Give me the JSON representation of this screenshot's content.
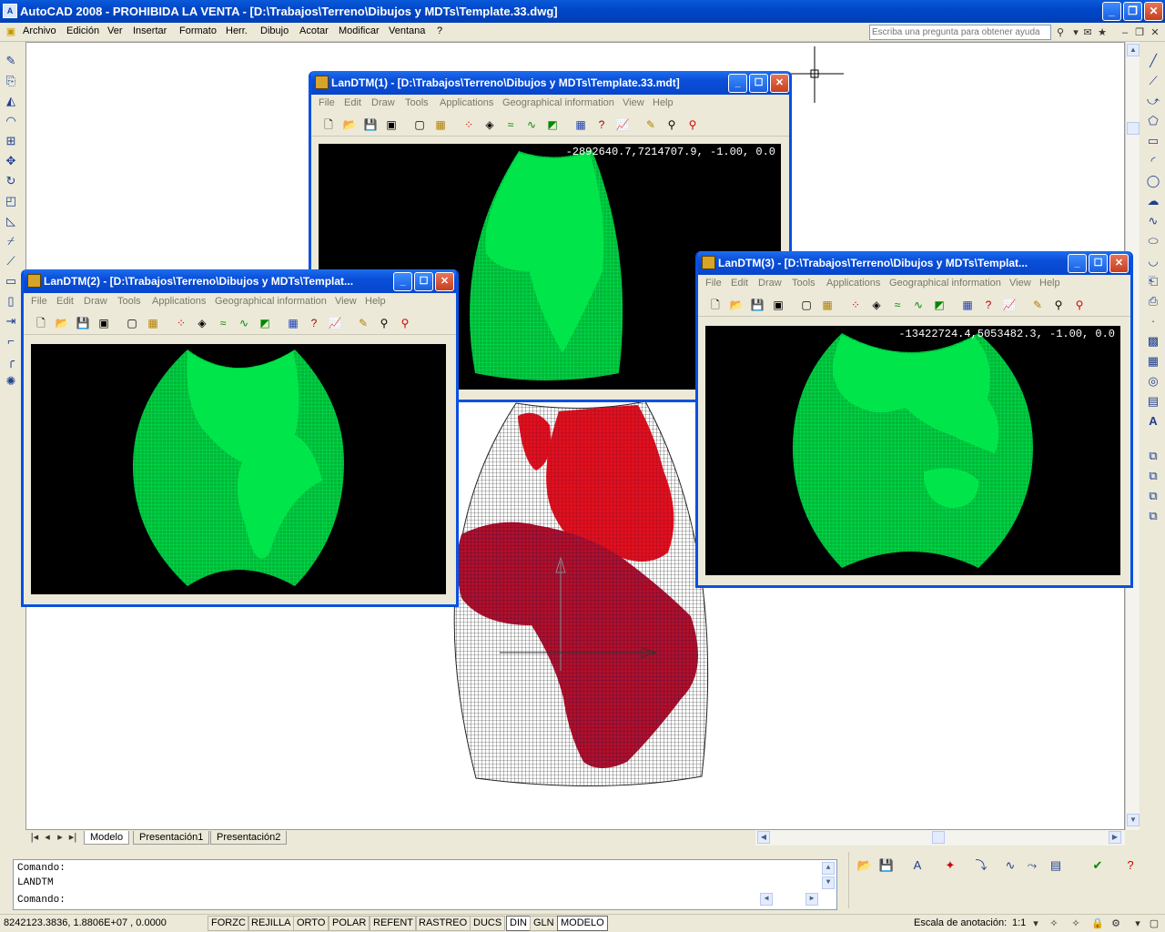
{
  "app": {
    "title": "AutoCAD 2008 - PROHIBIDA LA VENTA - [D:\\Trabajos\\Terreno\\Dibujos y MDTs\\Template.33.dwg]",
    "icon_label": "A"
  },
  "menu": [
    "Archivo",
    "Edición",
    "Ver",
    "Insertar",
    "Formato",
    "Herr.",
    "Dibujo",
    "Acotar",
    "Modificar",
    "Ventana",
    "?"
  ],
  "help_search": {
    "placeholder": "Escriba una pregunta para obtener ayuda"
  },
  "tabs": [
    "Modelo",
    "Presentación1",
    "Presentación2"
  ],
  "active_tab": "Modelo",
  "command": {
    "line1": "Comando:",
    "line2": "LANDTM",
    "prompt": "Comando:"
  },
  "status": {
    "coords": "8242123.3836, 1.8806E+07 , 0.0000",
    "toggles": [
      "FORZC",
      "REJILLA",
      "ORTO",
      "POLAR",
      "REFENT",
      "RASTREO",
      "DUCS",
      "DIN",
      "GLN",
      "MODELO"
    ],
    "active_toggles": [
      "DIN",
      "MODELO"
    ],
    "annotation_label": "Escala de anotación:",
    "annotation_value": "1:1"
  },
  "landtm_menu": [
    "File",
    "Edit",
    "Draw",
    "Tools",
    "Applications",
    "Geographical information",
    "View",
    "Help"
  ],
  "windows": [
    {
      "title": "LanDTM(1) - [D:\\Trabajos\\Terreno\\Dibujos y MDTs\\Template.33.mdt]",
      "coords": "-2892640.7,7214707.9, -1.00, 0.0"
    },
    {
      "title": "LanDTM(2) - [D:\\Trabajos\\Terreno\\Dibujos y MDTs\\Templat...",
      "coords": ""
    },
    {
      "title": "LanDTM(3) - [D:\\Trabajos\\Terreno\\Dibujos y MDTs\\Templat...",
      "coords": "-13422724.4,5053482.3, -1.00, 0.0"
    }
  ],
  "colors": {
    "titlebar": "#0047c8",
    "landmass": "#00e64a",
    "mesh_red": "#e0101e",
    "mesh_dark": "#7a0a30",
    "canvas_bg": "#000000"
  }
}
